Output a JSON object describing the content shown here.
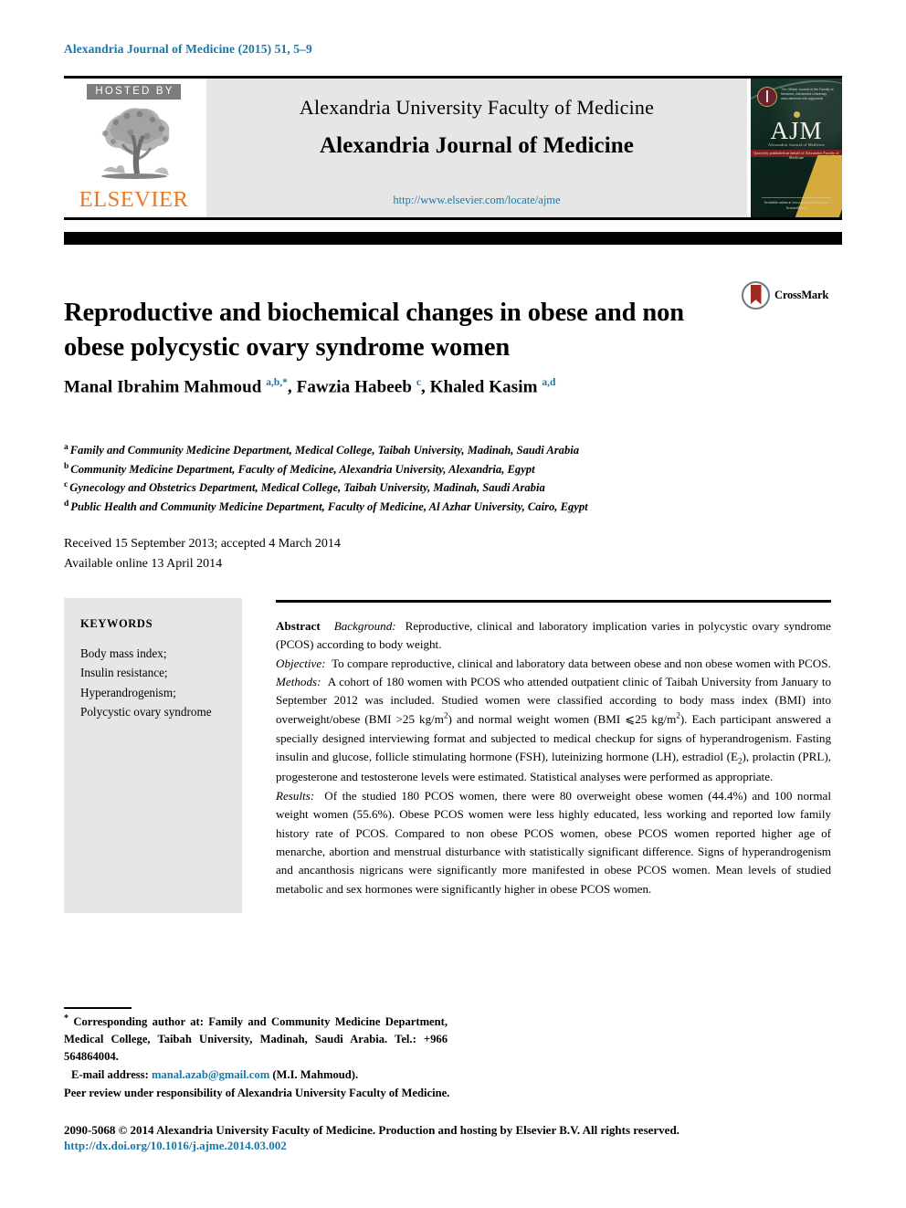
{
  "running_head": "Alexandria Journal of Medicine (2015) 51, 5–9",
  "masthead": {
    "hosted_by": "HOSTED BY",
    "publisher": "ELSEVIER",
    "faculty_line": "Alexandria University Faculty of Medicine",
    "journal_name": "Alexandria Journal of Medicine",
    "journal_url": "http://www.elsevier.com/locate/ajme",
    "cover": {
      "initials": "AJM",
      "subtitle": "Alexandria Journal of Medicine",
      "emblem_text": "The Official Journal of the Faculty of Medicine, Alexandria University, www.alexmed.edu.eg/journal",
      "band_text": "Quarterly published on behalf of Alexandria Faculty of Medicine",
      "footer_text": "Available online at www.sciencedirect.com / ScienceDirect"
    }
  },
  "article": {
    "title": "Reproductive and biochemical changes in obese and non obese polycystic ovary syndrome women",
    "crossmark_label": "CrossMark",
    "authors": [
      {
        "name": "Manal Ibrahim Mahmoud",
        "marks": "a,b,*"
      },
      {
        "name": "Fawzia Habeeb",
        "marks": "c"
      },
      {
        "name": "Khaled Kasim",
        "marks": "a,d"
      }
    ],
    "affiliations": [
      {
        "mark": "a",
        "text": "Family and Community Medicine Department, Medical College, Taibah University, Madinah, Saudi Arabia"
      },
      {
        "mark": "b",
        "text": "Community Medicine Department, Faculty of Medicine, Alexandria University, Alexandria, Egypt"
      },
      {
        "mark": "c",
        "text": "Gynecology and Obstetrics Department, Medical College, Taibah University, Madinah, Saudi Arabia"
      },
      {
        "mark": "d",
        "text": "Public Health and Community Medicine Department, Faculty of Medicine, Al Azhar University, Cairo, Egypt"
      }
    ],
    "dates_line1": "Received 15 September 2013; accepted 4 March 2014",
    "dates_line2": "Available online 13 April 2014"
  },
  "keywords": {
    "heading": "KEYWORDS",
    "items": [
      "Body mass index;",
      "Insulin resistance;",
      "Hyperandrogenism;",
      "Polycystic ovary syndrome"
    ]
  },
  "abstract": {
    "label": "Abstract",
    "sections": [
      {
        "heading": "Background:",
        "text": "Reproductive, clinical and laboratory implication varies in polycystic ovary syndrome (PCOS) according to body weight."
      },
      {
        "heading": "Objective:",
        "text": "To compare reproductive, clinical and laboratory data between obese and non obese women with PCOS."
      },
      {
        "heading": "Methods:",
        "text": "A cohort of 180 women with PCOS who attended outpatient clinic of Taibah University from January to September 2012 was included. Studied women were classified according to body mass index (BMI) into overweight/obese (BMI >25 kg/m2) and normal weight women (BMI ⩽25 kg/m2). Each participant answered a specially designed interviewing format and subjected to medical checkup for signs of hyperandrogenism. Fasting insulin and glucose, follicle stimulating hormone (FSH), luteinizing hormone (LH), estradiol (E2), prolactin (PRL), progesterone and testosterone levels were estimated. Statistical analyses were performed as appropriate."
      },
      {
        "heading": "Results:",
        "text": "Of the studied 180 PCOS women, there were 80 overweight obese women (44.4%) and 100 normal weight women (55.6%). Obese PCOS women were less highly educated, less working and reported low family history rate of PCOS. Compared to non obese PCOS women, obese PCOS women reported higher age of menarche, abortion and menstrual disturbance with statistically significant difference. Signs of hyperandrogenism and ancanthosis nigricans were significantly more manifested in obese PCOS women. Mean levels of studied metabolic and sex hormones were significantly higher in obese PCOS women."
      }
    ]
  },
  "footer": {
    "corresponding_note": "Corresponding author at: Family and Community Medicine Department, Medical College, Taibah University, Madinah, Saudi Arabia. Tel.: +966 564864004.",
    "email_label": "E-mail address:",
    "email": "manal.azab@gmail.com",
    "email_suffix": "(M.I. Mahmoud).",
    "peer_review": "Peer review under responsibility of Alexandria University Faculty of Medicine.",
    "copyright": "2090-5068 © 2014 Alexandria University Faculty of Medicine. Production and hosting by Elsevier B.V. All rights reserved.",
    "doi": "http://dx.doi.org/10.1016/j.ajme.2014.03.002"
  },
  "colors": {
    "link": "#1878a8",
    "elsevier_orange": "#e87722",
    "panel_gray": "#e6e6e6",
    "hosted_by_gray": "#7d7d7d"
  }
}
